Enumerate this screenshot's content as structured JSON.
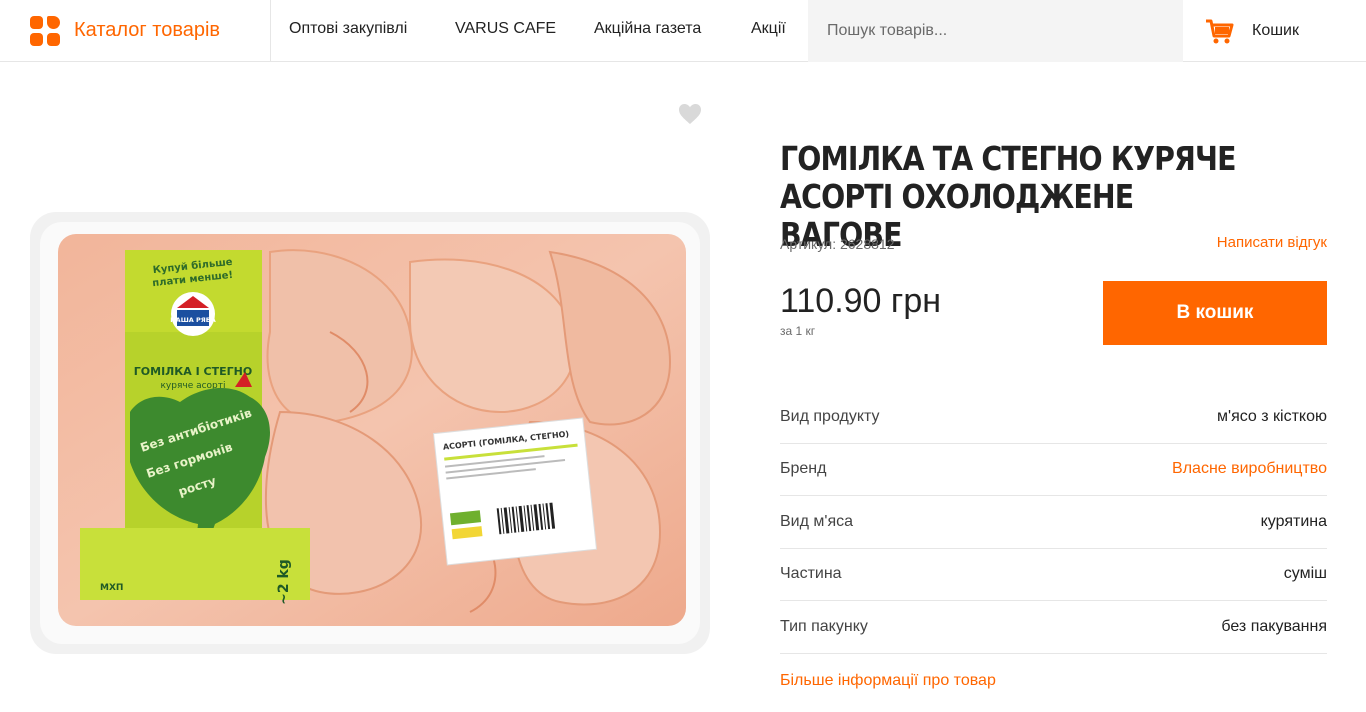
{
  "header": {
    "catalog_label": "Каталог товарів",
    "nav": [
      {
        "label": "Оптові закупівлі"
      },
      {
        "label": "VARUS CAFE"
      },
      {
        "label": "Акційна газета"
      },
      {
        "label": "Акції"
      }
    ],
    "search_placeholder": "Пошук товарів...",
    "cart_label": "Кошик",
    "icons": {
      "catalog": "grid-icon",
      "cart": "cart-icon",
      "favorite": "heart-icon"
    }
  },
  "colors": {
    "accent": "#ff6600",
    "text": "#222222",
    "muted": "#6a6a6a",
    "divider": "#e6e6e6"
  },
  "product": {
    "title": "Гомілка та стегно куряче асорті охолоджене вагове",
    "sku": "Артикул: 2628812",
    "review_link": "Написати відгук",
    "price": "110.90 грн",
    "unit": "за 1 кг",
    "buy_label": "В кошик",
    "attributes": [
      {
        "name": "Вид продукту",
        "value": "м'ясо з кісткою",
        "link": false
      },
      {
        "name": "Бренд",
        "value": "Власне виробництво",
        "link": true
      },
      {
        "name": "Вид м'яса",
        "value": "курятина",
        "link": false
      },
      {
        "name": "Частина",
        "value": "суміш",
        "link": false
      },
      {
        "name": "Тип пакунку",
        "value": "без пакування",
        "link": false
      }
    ],
    "more_link": "Більше інформації про товар"
  },
  "package_label": {
    "top": "Купуй більше",
    "top2": "плати менше!",
    "brand": "НАША РЯБА",
    "name": "ГОМІЛКА І СТЕГНО",
    "sub": "куряче асорті",
    "claim1": "Без антибіотиків",
    "claim2": "Без гормонів",
    "claim3": "росту",
    "weight": "~2 kg",
    "sticker": "АСОРТІ (ГОМІЛКА, СТЕГНО)",
    "maker": "МХП"
  }
}
